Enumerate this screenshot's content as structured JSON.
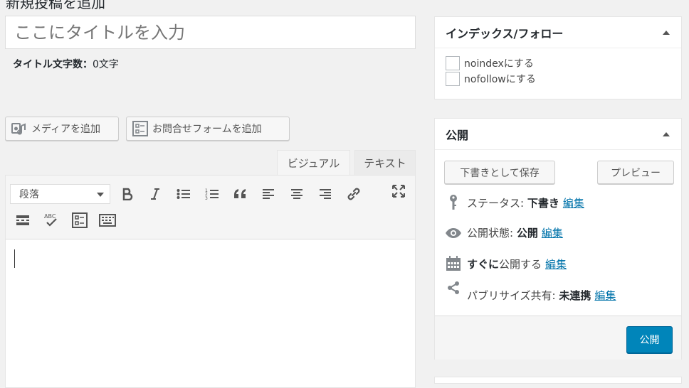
{
  "page": {
    "heading": "新規投稿を追加"
  },
  "title": {
    "placeholder": "ここにタイトルを入力",
    "count_label": "タイトル文字数：",
    "count_value": "0文字"
  },
  "media_buttons": {
    "add_media": "メディアを追加",
    "add_form": "お問合せフォームを追加"
  },
  "editor": {
    "tabs": [
      {
        "label": "ビジュアル"
      },
      {
        "label": "テキスト"
      }
    ],
    "format_select": "段落"
  },
  "index_follow": {
    "title": "インデックス/フォロー",
    "options": [
      {
        "label": "noindexにする"
      },
      {
        "label": "nofollowにする"
      }
    ]
  },
  "publish": {
    "title": "公開",
    "save_draft": "下書きとして保存",
    "preview": "プレビュー",
    "status_label": "ステータス:",
    "status_value": "下書き",
    "visibility_label": "公開状態:",
    "visibility_value": "公開",
    "schedule_label": "すぐに",
    "schedule_suffix": "公開する",
    "share_label": "パブリサイズ共有:",
    "share_value": "未連携",
    "edit_link": "編集",
    "publish_button": "公開"
  },
  "colors": {
    "primary": "#0085ba",
    "link": "#0073aa",
    "background": "#f1f1f1"
  }
}
